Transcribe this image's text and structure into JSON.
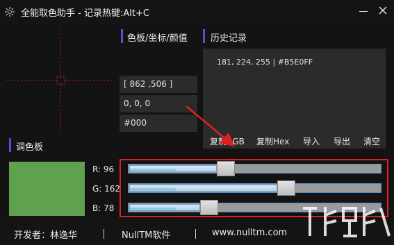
{
  "window": {
    "title": "全能取色助手  -  记录热键:Alt+C"
  },
  "crosshair": {
    "color": "#c81e1e"
  },
  "color_section": {
    "title": "色板/坐标/颜值",
    "coords": "[ 862 ,506 ]",
    "rgb": "0, 0, 0",
    "hex": "#000"
  },
  "history": {
    "title": "历史记录",
    "entries": [
      "181, 224, 255 | #B5E0FF"
    ],
    "buttons": [
      "复制RGB",
      "复制Hex",
      "导入",
      "导出",
      "清空"
    ]
  },
  "palette": {
    "title": "调色板",
    "swatch_color": "#5fa14f",
    "channels": [
      {
        "label": "R: 96",
        "value": 96,
        "max": 255
      },
      {
        "label": "G: 162",
        "value": 162,
        "max": 255
      },
      {
        "label": "B: 78",
        "value": 78,
        "max": 255
      }
    ]
  },
  "footer": {
    "developer": "开发者：林逸华",
    "brand": "NullTM软件",
    "website": "www.nulltm.com"
  },
  "colors": {
    "accent_bar": "#5b4bd6",
    "annotation_red": "#e02020",
    "panel_bg": "#2b2b2b",
    "window_bg": "#131313"
  }
}
